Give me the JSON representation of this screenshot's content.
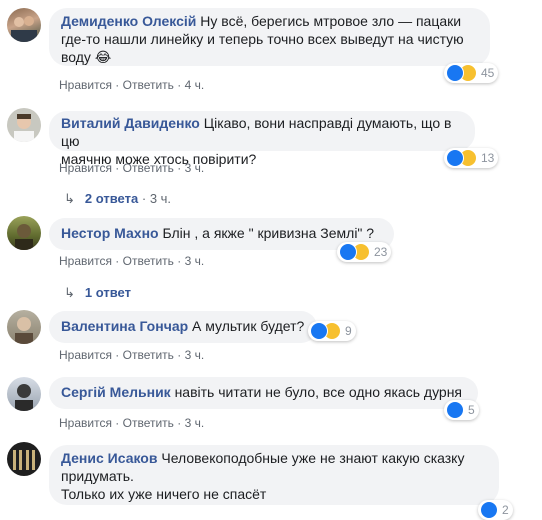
{
  "labels": {
    "like": "Нравится",
    "reply": "Ответить",
    "sep": "·"
  },
  "comments": [
    {
      "author": "Демиденко Олексій",
      "lines": [
        "Ну всё, берегись мтровое зло —  пацаки",
        "где-то нашли линейку и теперь точно всех выведут на чистую",
        "воду 😂"
      ],
      "time": "4 ч.",
      "reaction_count": "45",
      "reactions": [
        "like-icon",
        "haha-icon"
      ]
    },
    {
      "author": "Виталий Давиденко",
      "lines": [
        "Цікаво, вони насправді думають, що в цю",
        "маячню може хтось повірити?"
      ],
      "time": "3 ч.",
      "reaction_count": "13",
      "reactions": [
        "like-icon",
        "haha-icon"
      ],
      "replies": {
        "label": "2 ответа",
        "time": "3 ч."
      }
    },
    {
      "author": "Нестор Махно",
      "lines": [
        "Блін , а якже \" кривизна Землі\" ?"
      ],
      "time": "3 ч.",
      "reaction_count": "23",
      "reactions": [
        "like-icon",
        "haha-icon"
      ],
      "replies": {
        "label": "1 ответ"
      }
    },
    {
      "author": "Валентина Гончар",
      "lines": [
        "А мультик будет?"
      ],
      "time": "3 ч.",
      "reaction_count": "9",
      "reactions": [
        "like-icon",
        "sad-icon"
      ]
    },
    {
      "author": "Сергій Мельник",
      "lines": [
        "навіть читати не було, все одно якась дурня"
      ],
      "time": "3 ч.",
      "reaction_count": "5",
      "reactions": [
        "like-icon"
      ]
    },
    {
      "author": "Денис Исаков",
      "lines": [
        "Человекоподобные уже не знают какую сказку",
        "придумать.",
        "Только их уже ничего не спасёт"
      ],
      "time": "",
      "reaction_count": "2",
      "reactions": [
        "like-icon"
      ]
    }
  ],
  "colors": {
    "bubble": "#f2f3f5",
    "link": "#385898",
    "meta": "#606770",
    "like": "#1877f2",
    "haha": "#f7c02f"
  }
}
